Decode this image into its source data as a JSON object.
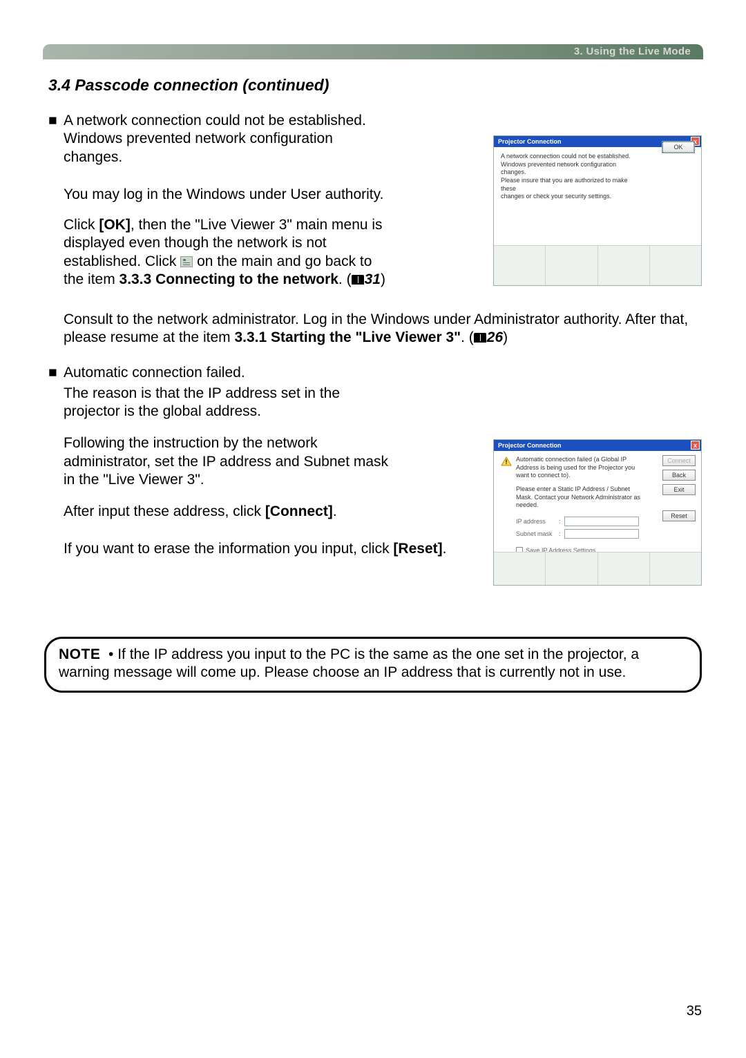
{
  "header": {
    "chapter_label": "3. Using the Live Mode"
  },
  "section_title": "3.4 Passcode connection (continued)",
  "bullet1": {
    "heading": "A network connection could not be established.",
    "p1": "Windows prevented network configuration changes.",
    "p2": "You may log in the Windows under User authority.",
    "p3a": "Click ",
    "p3_ok": "[OK]",
    "p3b": ", then the \"Live Viewer 3\" main menu is displayed even though the network is not established. Click ",
    "p3c": " on the main and go back to the item ",
    "p3_ref": "3.3.3 Connecting to the network",
    "p3d": ". (",
    "p3_page": "31",
    "p3e": ")",
    "p4a": "Consult to the network administrator. Log in the Windows under Administrator authority. After that, please resume at the item ",
    "p4_ref": "3.3.1 Starting the \"Live Viewer 3\"",
    "p4b": ". (",
    "p4_page": "26",
    "p4c": ")"
  },
  "bullet2": {
    "heading": "Automatic connection failed.",
    "p1": "The reason is that the IP address set in the projector is the global address.",
    "p2": "Following the instruction by the network administrator, set the IP address and Subnet mask in the \"Live Viewer 3\".",
    "p3a": "After input these address, click ",
    "p3_btn": "[Connect]",
    "p3b": ".",
    "p4a": "If you want to erase the information you input, click ",
    "p4_btn": "[Reset]",
    "p4b": "."
  },
  "dialog1": {
    "title": "Projector Connection",
    "msg_line1": "A network connection could not be established.",
    "msg_line2": "Windows prevented network configuration changes.",
    "msg_line3": "Please insure that you are authorized to make these",
    "msg_line4": "changes or check your security settings.",
    "ok": "OK"
  },
  "dialog2": {
    "title": "Projector Connection",
    "msg1": "Automatic connection failed (a Global IP Address is being used for the Projector you want to connect to).",
    "msg2": "Please enter a Static IP Address / Subnet Mask. Contact your Network Administrator as needed.",
    "btn_connect": "Connect",
    "btn_back": "Back",
    "btn_exit": "Exit",
    "btn_reset": "Reset",
    "ip_label": "IP address",
    "subnet_label": "Subnet mask",
    "save_label": "Save IP Address Settings"
  },
  "note": {
    "label": "NOTE",
    "bullet": "•",
    "text": " If the IP address you input to the PC is the same as the one set in the projector, a warning message will come up.  Please choose an IP address that is currently not in use."
  },
  "page_number": "35"
}
